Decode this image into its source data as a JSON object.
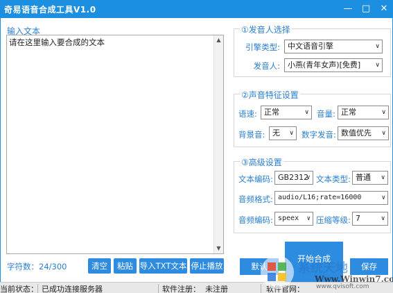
{
  "window": {
    "title": "奇易语音合成工具V1.0",
    "minimize": "—",
    "maximize": "□",
    "close": "✕"
  },
  "input": {
    "label": "输入文本",
    "text": "请在这里输入要合成的文本",
    "char_count": "字符数：24/300"
  },
  "bottom_buttons": {
    "clear": "清空",
    "paste": "粘贴",
    "import_txt": "导入TXT文本",
    "stop": "停止播放"
  },
  "speaker_group": {
    "title": "①发音人选择",
    "engine_label": "引擎类型:",
    "engine_value": "中文语音引擎",
    "speaker_label": "发音人:",
    "speaker_value": "小燕(青年女声)[免费]"
  },
  "voice_group": {
    "title": "②声音特征设置",
    "speed_label": "语速:",
    "speed_value": "正常",
    "volume_label": "音量:",
    "volume_value": "正常",
    "bgm_label": "背景音:",
    "bgm_value": "无",
    "digit_label": "数字发音:",
    "digit_value": "数值优先"
  },
  "advanced_group": {
    "title": "③高级设置",
    "encoding_label": "文本编码:",
    "encoding_value": "GB2312",
    "text_type_label": "文本类型:",
    "text_type_value": "普通",
    "audio_format_label": "音频格式:",
    "audio_format_value": "audio/L16;rate=16000",
    "audio_codec_label": "音频编码:",
    "audio_codec_value": "speex",
    "compress_label": "压缩等级:",
    "compress_value": "7"
  },
  "actions": {
    "default_partial": "默认",
    "start": "开始合成",
    "save_partial": "保存"
  },
  "status": {
    "current_state_label": "当前状态：",
    "current_state_value": "已成功连接服务器",
    "registration_label": "软件注册：",
    "registration_value": "未注册",
    "website_label": "软件官网："
  },
  "watermark": {
    "line1": "系统天地",
    "line2": "Www.Winwin7.com",
    "line3": "www.qvisoft.com"
  },
  "colors": {
    "titlebar": "#1d8fe0",
    "button": "#2d8be0",
    "label": "#2a7fd0"
  }
}
